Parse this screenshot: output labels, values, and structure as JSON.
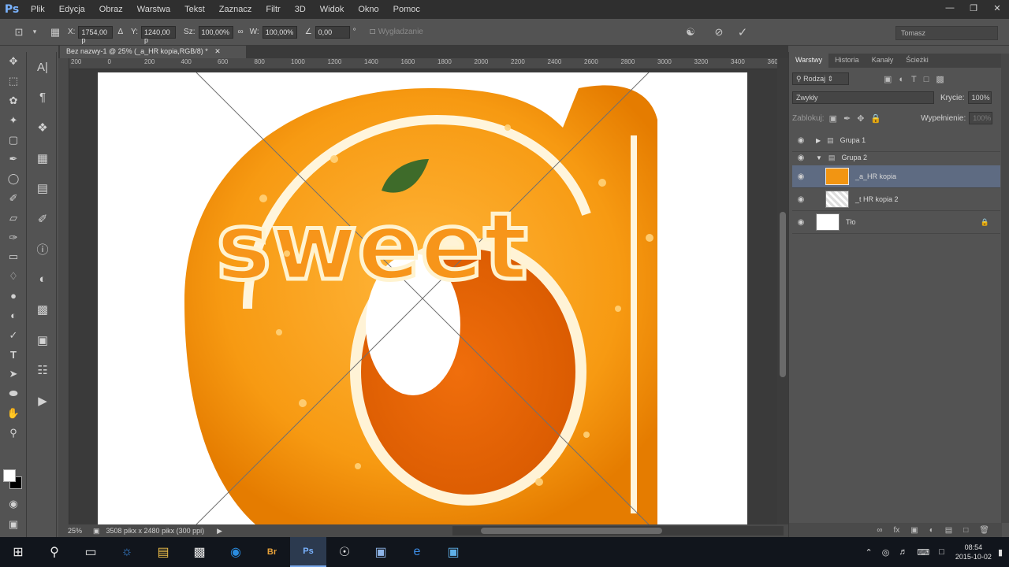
{
  "app": {
    "logo": "Ps"
  },
  "menu": [
    "Plik",
    "Edycja",
    "Obraz",
    "Warstwa",
    "Tekst",
    "Zaznacz",
    "Filtr",
    "3D",
    "Widok",
    "Okno",
    "Pomoc"
  ],
  "options": {
    "x_label": "X:",
    "x_value": "1754,00 p",
    "y_label": "Y:",
    "y_value": "1240,00 p",
    "w_label": "Sz:",
    "w_value": "100,00%",
    "h_label": "W:",
    "h_value": "100,00%",
    "angle_value": "0,00",
    "smoothing_label": "Wygładzanie",
    "workspace": "Tomasz"
  },
  "document": {
    "tab_title": "Bez nazwy-1 @ 25% (_a_HR kopia,RGB/8) *",
    "artwork_text": "sweet",
    "zoom": "25%",
    "size_info": "3508 pikx x 2480 pikx (300 ppi)"
  },
  "ruler_ticks": [
    "200",
    "0",
    "200",
    "400",
    "600",
    "800",
    "1000",
    "1200",
    "1400",
    "1600",
    "1800",
    "2000",
    "2200",
    "2400",
    "2600",
    "2800",
    "3000",
    "3200",
    "3400",
    "3600"
  ],
  "panel": {
    "tabs": [
      "Warstwy",
      "Historia",
      "Kanały",
      "Ścieżki"
    ],
    "filter_kind": "Rodzaj",
    "blend_mode": "Zwykły",
    "opacity_label": "Krycie:",
    "opacity_value": "100%",
    "lock_label": "Zablokuj:",
    "fill_label": "Wypełnienie:",
    "fill_value": "100%",
    "layers": [
      {
        "name": "Grupa 1",
        "type": "group"
      },
      {
        "name": "Grupa 2",
        "type": "group"
      },
      {
        "name": "_a_HR kopia",
        "type": "layer"
      },
      {
        "name": "_t HR kopia 2",
        "type": "layer"
      },
      {
        "name": "Tło",
        "type": "background"
      }
    ]
  },
  "taskbar": {
    "time": "08:54",
    "date": "2015-10-02"
  }
}
